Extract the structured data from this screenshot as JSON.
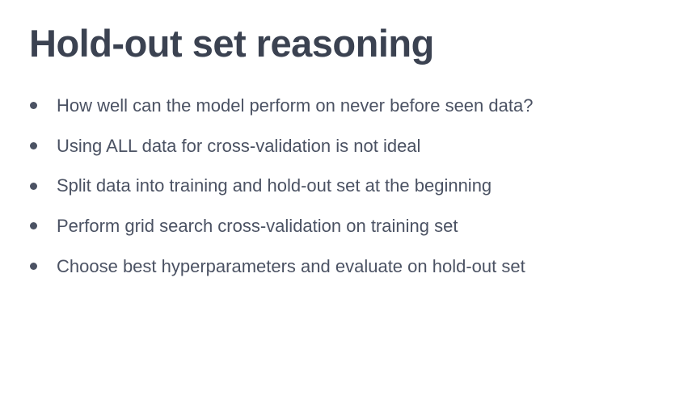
{
  "slide": {
    "title": "Hold-out set reasoning",
    "bullets": [
      "How well can the model perform on never before seen data?",
      "Using ALL data for cross-validation is not ideal",
      "Split data into training and hold-out set at the beginning",
      "Perform grid search cross-validation on training set",
      "Choose best hyperparameters and evaluate on hold-out set"
    ]
  },
  "colors": {
    "title": "#3b4251",
    "body_text": "#4b5263",
    "background": "#ffffff"
  }
}
